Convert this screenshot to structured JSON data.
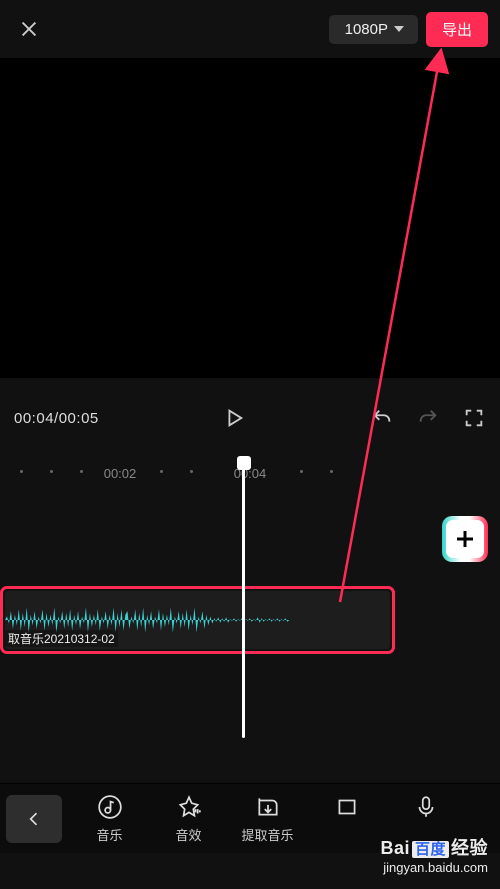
{
  "header": {
    "resolution_label": "1080P",
    "export_label": "导出"
  },
  "controls": {
    "current_time": "00:04",
    "total_time": "00:05"
  },
  "timeline": {
    "ticks": [
      "00:02",
      "00:04"
    ],
    "clip_label": "取音乐20210312-02"
  },
  "toolbar": {
    "music_label": "音乐",
    "sfx_label": "音效",
    "extract_label": "提取音乐"
  },
  "watermark": {
    "brand_prefix": "Bai",
    "brand_box": "百度",
    "brand_suffix": "经验",
    "url": "jingyan.baidu.com"
  }
}
